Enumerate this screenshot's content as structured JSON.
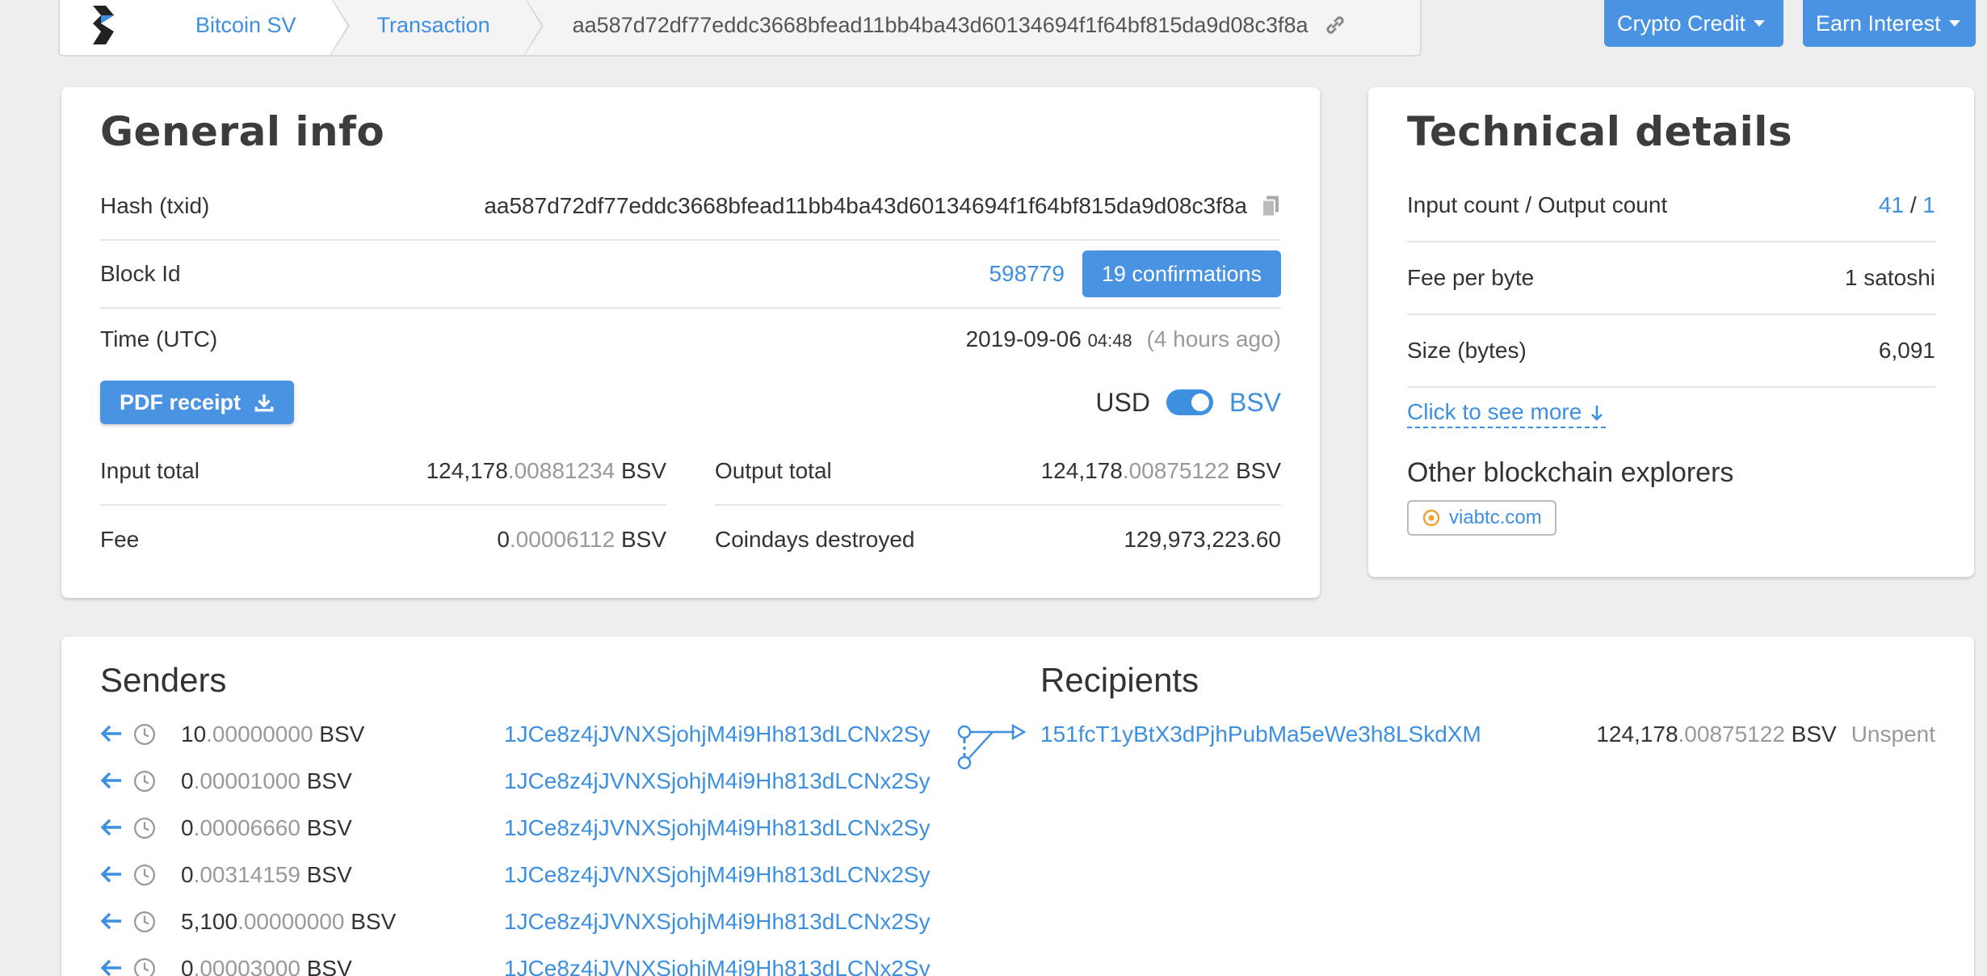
{
  "breadcrumb": {
    "items": [
      "Bitcoin SV",
      "Transaction"
    ],
    "hash": "aa587d72df77eddc3668bfead11bb4ba43d60134694f1f64bf815da9d08c3f8a"
  },
  "top_buttons": {
    "crypto_credit": "Crypto Credit",
    "earn_interest": "Earn Interest"
  },
  "general": {
    "title": "General info",
    "hash_label": "Hash (txid)",
    "hash_value": "aa587d72df77eddc3668bfead11bb4ba43d60134694f1f64bf815da9d08c3f8a",
    "block_label": "Block Id",
    "block_value": "598779",
    "confirmations": "19 confirmations",
    "time_label": "Time (UTC)",
    "time_date": "2019-09-06",
    "time_clock": "04:48",
    "time_ago": "(4 hours ago)",
    "pdf_label": "PDF receipt",
    "currency_left": "USD",
    "currency_right": "BSV",
    "input_total_label": "Input total",
    "input_total_int": "124,178",
    "input_total_dec": ".00881234",
    "output_total_label": "Output total",
    "output_total_int": "124,178",
    "output_total_dec": ".00875122",
    "fee_label": "Fee",
    "fee_int": "0",
    "fee_dec": ".00006112",
    "coindays_label": "Coindays destroyed",
    "coindays_value": "129,973,223.60",
    "unit": "BSV"
  },
  "tech": {
    "title": "Technical details",
    "io_label": "Input count / Output count",
    "input_count": "41",
    "separator": "/",
    "output_count": "1",
    "fee_byte_label": "Fee per byte",
    "fee_byte_value": "1 satoshi",
    "size_label": "Size (bytes)",
    "size_value": "6,091",
    "more_link": "Click to see more",
    "explorers_title": "Other blockchain explorers",
    "explorer": "viabtc.com"
  },
  "senders": {
    "title": "Senders",
    "rows": [
      {
        "int": "10",
        "dec": ".00000000",
        "unit": "BSV",
        "address": "1JCe8z4jJVNXSjohjM4i9Hh813dLCNx2Sy"
      },
      {
        "int": "0",
        "dec": ".00001000",
        "unit": "BSV",
        "address": "1JCe8z4jJVNXSjohjM4i9Hh813dLCNx2Sy"
      },
      {
        "int": "0",
        "dec": ".00006660",
        "unit": "BSV",
        "address": "1JCe8z4jJVNXSjohjM4i9Hh813dLCNx2Sy"
      },
      {
        "int": "0",
        "dec": ".00314159",
        "unit": "BSV",
        "address": "1JCe8z4jJVNXSjohjM4i9Hh813dLCNx2Sy"
      },
      {
        "int": "5,100",
        "dec": ".00000000",
        "unit": "BSV",
        "address": "1JCe8z4jJVNXSjohjM4i9Hh813dLCNx2Sy"
      },
      {
        "int": "0",
        "dec": ".00003000",
        "unit": "BSV",
        "address": "1JCe8z4jJVNXSjohjM4i9Hh813dLCNx2Sy"
      }
    ]
  },
  "recipients": {
    "title": "Recipients",
    "rows": [
      {
        "address": "151fcT1yBtX3dPjhPubMa5eWe3h8LSkdXM",
        "int": "124,178",
        "dec": ".00875122",
        "unit": "BSV",
        "status": "Unspent"
      }
    ]
  }
}
